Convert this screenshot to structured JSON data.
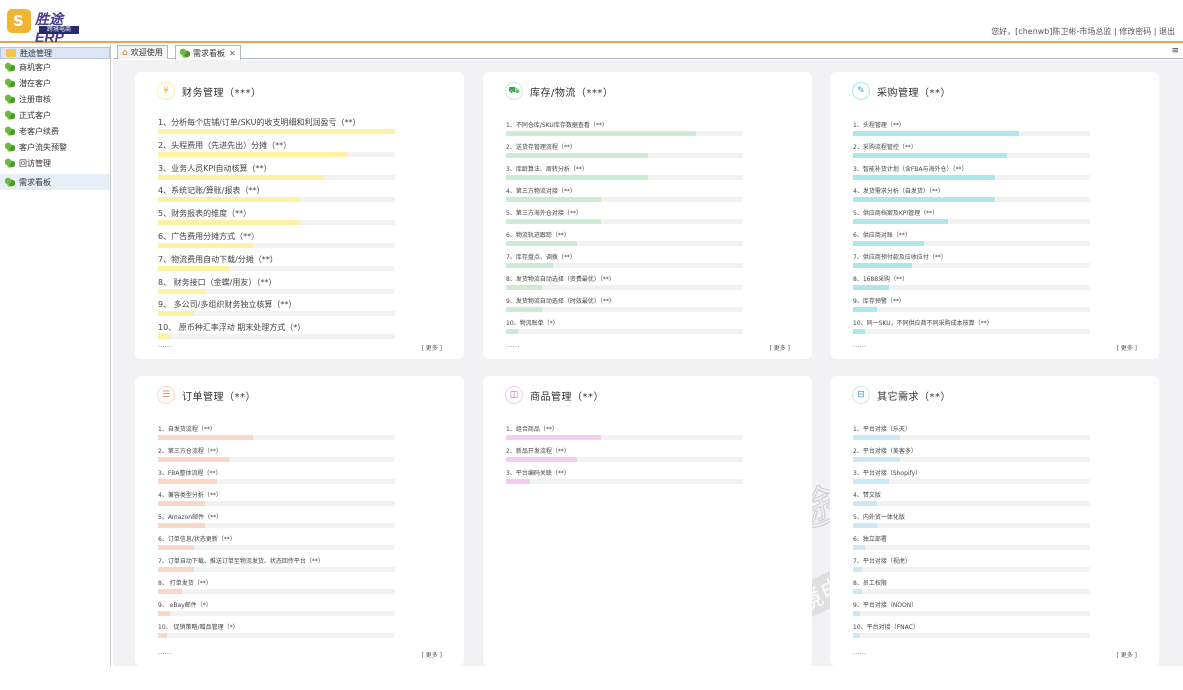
{
  "app": {
    "logo_text": "胜途ERP",
    "logo_sub": "跨境电商"
  },
  "user": {
    "greeting": "您好，[chenwb]陈卫彬-市场总监",
    "sep1": "|",
    "change_password": "修改密码",
    "sep2": "|",
    "logout": "退出"
  },
  "sidebar": {
    "root": "胜途管理",
    "items": [
      {
        "label": "商机客户"
      },
      {
        "label": "潜在客户"
      },
      {
        "label": "注册审核"
      },
      {
        "label": "正式客户"
      },
      {
        "label": "老客户续费"
      },
      {
        "label": "客户流失预警"
      },
      {
        "label": "回访管理"
      },
      {
        "label": "需求看板"
      }
    ]
  },
  "tabs": [
    {
      "label": "欢迎使用"
    },
    {
      "label": "需求看板",
      "close": "✕"
    }
  ],
  "colors": {
    "finance": "#fdf1a6",
    "inventory": "#cdebd3",
    "purchase": "#ade7ea",
    "order": "#fbd7c8",
    "product": "#f4cdee",
    "other": "#cce8f4"
  },
  "cards": [
    {
      "key": "finance",
      "title": "财务管理（***）",
      "icon": "money-icon",
      "more": "[ 更多 ]",
      "dots": "......",
      "size": "large",
      "items": [
        {
          "text": "1、分析每个店铺/订单/SKU的收支明细和利润盈亏（**）",
          "level": 1.0
        },
        {
          "text": "2、头程费用（先进先出）分摊（**）",
          "level": 0.8
        },
        {
          "text": "3、业务人员KPI自动核算（**）",
          "level": 0.7
        },
        {
          "text": "4、系统记账/算账/报表（**）",
          "level": 0.6
        },
        {
          "text": "5、财务报表的维度（**）",
          "level": 0.6
        },
        {
          "text": "6、广告费用分摊方式（**）",
          "level": 0.4
        },
        {
          "text": "7、物流费用自动下载/分摊（**）",
          "level": 0.3
        },
        {
          "text": "8、 财务接口（金蝶/用友）（**）",
          "level": 0.2
        },
        {
          "text": "9、 多公司/多组织财务独立核算（**）",
          "level": 0.15
        },
        {
          "text": "10、 原币种汇率浮动 期末处理方式（*）",
          "level": 0.05
        }
      ]
    },
    {
      "key": "inventory",
      "title": "库存/物流（***）",
      "icon": "truck-icon",
      "more": "[ 更多 ]",
      "dots": "......",
      "size": "small",
      "items": [
        {
          "text": "1、不同仓库/SKU库存数据查看（**）",
          "level": 0.8
        },
        {
          "text": "2、送货存管理流程（**）",
          "level": 0.6
        },
        {
          "text": "3、库龄算法、周转分析（**）",
          "level": 0.6
        },
        {
          "text": "4、第三方物流对接（**）",
          "level": 0.4
        },
        {
          "text": "5、第三方海外仓对接（**）",
          "level": 0.4
        },
        {
          "text": "6、物流轨迹跟踪（**）",
          "level": 0.3
        },
        {
          "text": "7、库存盘点、调拨（**）",
          "level": 0.2
        },
        {
          "text": "8、发货物流自动选择（资费最优）（**）",
          "level": 0.15
        },
        {
          "text": "9、发货物流自动选择（时效最优）（**）",
          "level": 0.15
        },
        {
          "text": "10、物流账单（*）",
          "level": 0.05
        }
      ]
    },
    {
      "key": "purchase",
      "title": "采购管理（**）",
      "icon": "purchase-icon",
      "more": "[ 更多 ]",
      "dots": "......",
      "size": "small",
      "items": [
        {
          "text": "1、头程管理（**）",
          "level": 0.7
        },
        {
          "text": "2、采购流程管控（**）",
          "level": 0.65
        },
        {
          "text": "3、智能补货计划（含FBA与海外仓）（**）",
          "level": 0.6
        },
        {
          "text": "4、发货需求分析（自发货）（**）",
          "level": 0.6
        },
        {
          "text": "5、供应商档案及KPI管理（**）",
          "level": 0.4
        },
        {
          "text": "6、供应商对账（**）",
          "level": 0.3
        },
        {
          "text": "7、供应商预付款及应收应付（**）",
          "level": 0.25
        },
        {
          "text": "8、1688采购（**）",
          "level": 0.15
        },
        {
          "text": "9、库存预警（**）",
          "level": 0.1
        },
        {
          "text": "10、同一SKU，不同供应商不同采购成本核算（**）",
          "level": 0.05
        }
      ]
    },
    {
      "key": "order",
      "title": "订单管理（**）",
      "icon": "order-icon",
      "more": "[ 更多 ]",
      "dots": "......",
      "size": "small",
      "items": [
        {
          "text": "1、自发货流程（**）",
          "level": 0.4
        },
        {
          "text": "2、第三方仓流程（**）",
          "level": 0.3
        },
        {
          "text": "3、FBA整体流程（**）",
          "level": 0.25
        },
        {
          "text": "4、兼容类型分析（**）",
          "level": 0.2
        },
        {
          "text": "5、Amazon邮件（**）",
          "level": 0.2
        },
        {
          "text": "6、订单信息/状态更新（**）",
          "level": 0.15
        },
        {
          "text": "7、订单自动下载、推送订单至物流发货、状态回传平台（**）",
          "level": 0.15
        },
        {
          "text": "8、 打单发货（**）",
          "level": 0.1
        },
        {
          "text": "9、 eBay邮件（*）",
          "level": 0.05
        },
        {
          "text": "10、 促销策略/赠品管理（*）",
          "level": 0.04
        }
      ]
    },
    {
      "key": "product",
      "title": "商品管理（**）",
      "icon": "box-icon",
      "more": "",
      "dots": "",
      "size": "small",
      "items": [
        {
          "text": "1、组合商品（**）",
          "level": 0.4
        },
        {
          "text": "2、新品开发流程（**）",
          "level": 0.3
        },
        {
          "text": "3、平台编码关联（**）",
          "level": 0.1
        }
      ]
    },
    {
      "key": "other",
      "title": "其它需求（**）",
      "icon": "other-icon",
      "more": "[ 更多 ]",
      "dots": "......",
      "size": "small",
      "items": [
        {
          "text": "1、平台对接（乐天）",
          "level": 0.2
        },
        {
          "text": "2、平台对接（美客多）",
          "level": 0.2
        },
        {
          "text": "3、平台对接（Shopify）",
          "level": 0.15
        },
        {
          "text": "4、赞文版",
          "level": 0.1
        },
        {
          "text": "5、内外贸一体化版",
          "level": 0.1
        },
        {
          "text": "6、独立部署",
          "level": 0.05
        },
        {
          "text": "7、平台对接（视虎）",
          "level": 0.04
        },
        {
          "text": "8、员工权限",
          "level": 0.04
        },
        {
          "text": "9、平台对接（NOON）",
          "level": 0.03
        },
        {
          "text": "10、平台对接（FNAC）",
          "level": 0.03
        }
      ]
    }
  ],
  "watermark": {
    "line1": "胜途ERP",
    "line2": "跨境电商"
  }
}
